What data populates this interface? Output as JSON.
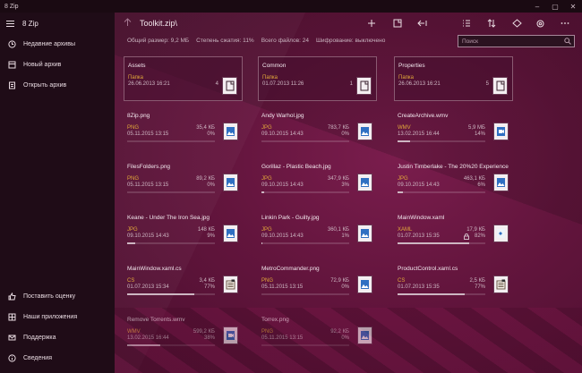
{
  "window": {
    "title": "8 Zip",
    "minimize": "–",
    "maximize": "▢",
    "close": "✕"
  },
  "sidebar": {
    "title": "8 Zip",
    "items": [
      {
        "label": "Недавние архивы",
        "icon": "clock-icon"
      },
      {
        "label": "Новый архив",
        "icon": "new-archive-icon"
      },
      {
        "label": "Открыть архив",
        "icon": "open-archive-icon"
      }
    ],
    "bottom_items": [
      {
        "label": "Поставить оценку",
        "icon": "thumbs-up-icon"
      },
      {
        "label": "Наши приложения",
        "icon": "apps-icon"
      },
      {
        "label": "Поддержка",
        "icon": "mail-icon"
      },
      {
        "label": "Сведения",
        "icon": "info-icon"
      }
    ]
  },
  "toolbar": {
    "path": "Toolkit.zip\\",
    "buttons": [
      "add-icon",
      "new-folder-icon",
      "extract-icon",
      "select-icon",
      "sort-icon",
      "share-icon",
      "settings-icon",
      "more-icon"
    ]
  },
  "status": {
    "total_size": "Общий размер: 9,2 МБ",
    "compression": "Степень сжатия: 11%",
    "files": "Всего файлов: 24",
    "encryption": "Шифрование: выключено"
  },
  "search": {
    "placeholder": "Поиск"
  },
  "folders": [
    {
      "name": "Assets",
      "type": "Папка",
      "date": "26.06.2013 16:21",
      "count": "4"
    },
    {
      "name": "Common",
      "type": "Папка",
      "date": "01.07.2013 11:26",
      "count": "1"
    },
    {
      "name": "Properties",
      "type": "Папка",
      "date": "26.06.2013 16:21",
      "count": "5"
    }
  ],
  "files": [
    {
      "name": "8Zip.png",
      "type": "PNG",
      "date": "05.11.2015 13:15",
      "size": "35,4 КБ",
      "ratio": "0%",
      "kind": "image",
      "progress": 0
    },
    {
      "name": "Andy Warhol.jpg",
      "type": "JPG",
      "date": "09.10.2015 14:43",
      "size": "783,7 КБ",
      "ratio": "0%",
      "kind": "image",
      "progress": 0
    },
    {
      "name": "CreateArchive.wmv",
      "type": "WMV",
      "date": "13.02.2015 16:44",
      "size": "5,9 МБ",
      "ratio": "14%",
      "kind": "video",
      "progress": 0.14
    },
    {
      "name": "FilesFolders.png",
      "type": "PNG",
      "date": "05.11.2015 13:15",
      "size": "89,2 КБ",
      "ratio": "0%",
      "kind": "image",
      "progress": 0
    },
    {
      "name": "Gorillaz - Plastic Beach.jpg",
      "type": "JPG",
      "date": "09.10.2015 14:43",
      "size": "347,9 КБ",
      "ratio": "3%",
      "kind": "image",
      "progress": 0.03
    },
    {
      "name": "Justin Timberlake - The 20%20 Experience.jpg",
      "type": "JPG",
      "date": "09.10.2015 14:43",
      "size": "463,1 КБ",
      "ratio": "6%",
      "kind": "image",
      "progress": 0.06
    },
    {
      "name": "Keane - Under The Iron Sea.jpg",
      "type": "JPG",
      "date": "09.10.2015 14:43",
      "size": "148 КБ",
      "ratio": "9%",
      "kind": "image",
      "progress": 0.09
    },
    {
      "name": "Linkin Park - Guilty.jpg",
      "type": "JPG",
      "date": "09.10.2015 14:43",
      "size": "360,1 КБ",
      "ratio": "1%",
      "kind": "image",
      "progress": 0.01
    },
    {
      "name": "MainWindow.xaml",
      "type": "XAML",
      "date": "01.07.2013 15:35",
      "size": "17,9 КБ",
      "ratio": "82%",
      "kind": "code",
      "progress": 0.82,
      "locked": true
    },
    {
      "name": "MainWindow.xaml.cs",
      "type": "CS",
      "date": "01.07.2013 15:34",
      "size": "3,4 КБ",
      "ratio": "77%",
      "kind": "doc",
      "progress": 0.77
    },
    {
      "name": "MetroCommander.png",
      "type": "PNG",
      "date": "05.11.2015 13:15",
      "size": "72,9 КБ",
      "ratio": "0%",
      "kind": "image",
      "progress": 0
    },
    {
      "name": "ProductControl.xaml.cs",
      "type": "CS",
      "date": "01.07.2013 15:35",
      "size": "2,5 КБ",
      "ratio": "77%",
      "kind": "doc",
      "progress": 0.77
    },
    {
      "name": "Remove Torrents.wmv",
      "type": "WMV",
      "date": "13.02.2015 16:44",
      "size": "599,2 КБ",
      "ratio": "38%",
      "kind": "video",
      "progress": 0.38
    },
    {
      "name": "Torrex.png",
      "type": "PNG",
      "date": "05.11.2015 13:15",
      "size": "92,2 КБ",
      "ratio": "0%",
      "kind": "image",
      "progress": 0
    }
  ],
  "colors": {
    "accent": "#e3a93a",
    "background": "#63153d",
    "sidebar": "#1f0c17"
  }
}
